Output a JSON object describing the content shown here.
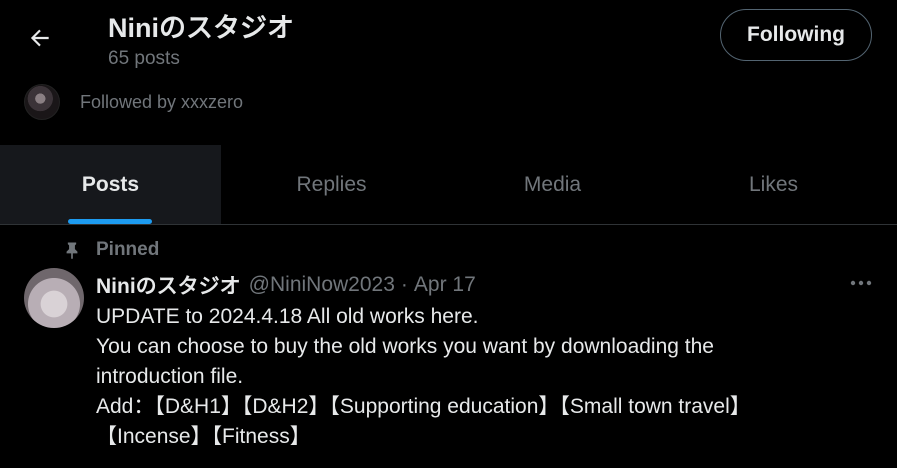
{
  "header": {
    "title": "Niniのスタジオ",
    "posts_count": "65 posts",
    "follow_button": "Following",
    "followed_by": "Followed by xxxzero"
  },
  "tabs": [
    {
      "label": "Posts",
      "active": true
    },
    {
      "label": "Replies",
      "active": false
    },
    {
      "label": "Media",
      "active": false
    },
    {
      "label": "Likes",
      "active": false
    }
  ],
  "post": {
    "pinned_label": "Pinned",
    "author": "Niniのスタジオ",
    "handle": "@NiniNow2023",
    "separator": "·",
    "date": "Apr 17",
    "lines": [
      "UPDATE to 2024.4.18 All old works here.",
      "You can choose to buy the old works you want by downloading the",
      "introduction file.",
      "Add：【D&H1】【D&H2】【Supporting education】【Small town travel】",
      "【Incense】【Fitness】"
    ]
  },
  "colors": {
    "background": "#000000",
    "text": "#e7e9ea",
    "muted": "#71767b",
    "accent": "#1d9bf0",
    "border": "#2f3336"
  },
  "icons": {
    "back": "arrow-left-icon",
    "pin": "pin-icon",
    "more": "more-horizontal-icon"
  }
}
